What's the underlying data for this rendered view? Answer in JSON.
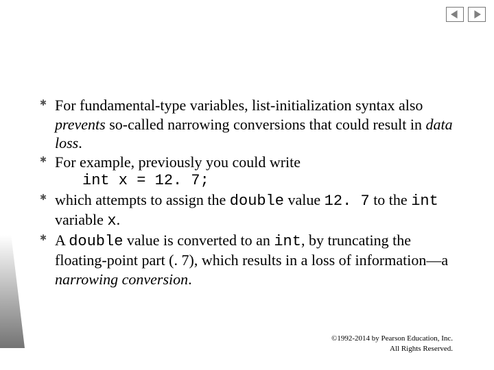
{
  "nav": {
    "prev_name": "prev-slide-button",
    "next_name": "next-slide-button"
  },
  "bullets": {
    "b1_a": "For fundamental-type variables, list-initialization syntax also ",
    "b1_prevents": "prevents",
    "b1_b": " so-called ",
    "b1_narrowing": "narrowing conversions",
    "b1_c": " that could result in ",
    "b1_dataloss": "data loss",
    "b1_d": ".",
    "b2": "For example, previously you could write",
    "code": "int x = 12. 7;",
    "b3_a": "which attempts to assign the ",
    "b3_double": "double",
    "b3_b": " value ",
    "b3_val": "12. 7",
    "b3_c": " to the ",
    "b3_int": "int",
    "b3_d": " variable ",
    "b3_x": "x",
    "b3_e": ".",
    "b4_a": "A ",
    "b4_double": "double",
    "b4_b": " value is converted to an ",
    "b4_int": "int",
    "b4_c": ", by truncating the floating-point part (. 7), which results in a loss of information—a ",
    "b4_narrowing": "narrowing conversion",
    "b4_d": "."
  },
  "footer": {
    "line1": "©1992-2014 by Pearson Education, Inc.",
    "line2": "All Rights Reserved."
  }
}
